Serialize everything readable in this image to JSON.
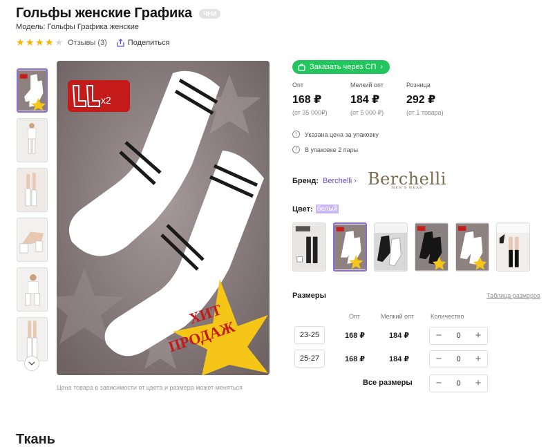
{
  "product": {
    "title": "Гольфы женские Графика",
    "badge": "ЧНИ",
    "model": "Модель: Гольфы Графика женские",
    "rating": 4,
    "reviews": "Отзывы (3)",
    "share": "Поделиться"
  },
  "gallery": {
    "badge_x2": "x2",
    "hit_line1": "ХИТ",
    "hit_line2": "ПРОДАЖ",
    "caption": "Цена товара в зависимости от цвета и размера может меняться"
  },
  "order": {
    "label": "Заказать через СП"
  },
  "prices": [
    {
      "label": "Опт",
      "value": "168 ₽",
      "note": "(от 35 000₽)"
    },
    {
      "label": "Мелкий опт",
      "value": "184 ₽",
      "note": "(от 5 000 ₽)"
    },
    {
      "label": "Розница",
      "value": "292 ₽",
      "note": "(от 1 товара)"
    }
  ],
  "info": {
    "line1": "Указана цена за упаковку",
    "line2": "В упаковке 2 пары"
  },
  "brand": {
    "label": "Бренд:",
    "name": "Berchelli",
    "logo_main": "Berchelli",
    "logo_sub": "MEN'S WEAR"
  },
  "color": {
    "label": "Цвет:",
    "value": "белый"
  },
  "sizes": {
    "title": "Размеры",
    "table_link": "Таблица размеров",
    "headers": {
      "opt": "Опт",
      "small_opt": "Мелкий опт",
      "quantity": "Количество"
    },
    "rows": [
      {
        "size": "23-25",
        "opt": "168 ₽",
        "small_opt": "184 ₽",
        "qty": "0"
      },
      {
        "size": "25-27",
        "opt": "168 ₽",
        "small_opt": "184 ₽",
        "qty": "0"
      }
    ],
    "all_label": "Все размеры",
    "all_qty": "0"
  },
  "fabric": {
    "title": "Ткань"
  },
  "colors": {
    "accent": "#8a6dd8",
    "green": "#22c55e",
    "link": "#6a4bd0",
    "star": "#f7b500"
  }
}
